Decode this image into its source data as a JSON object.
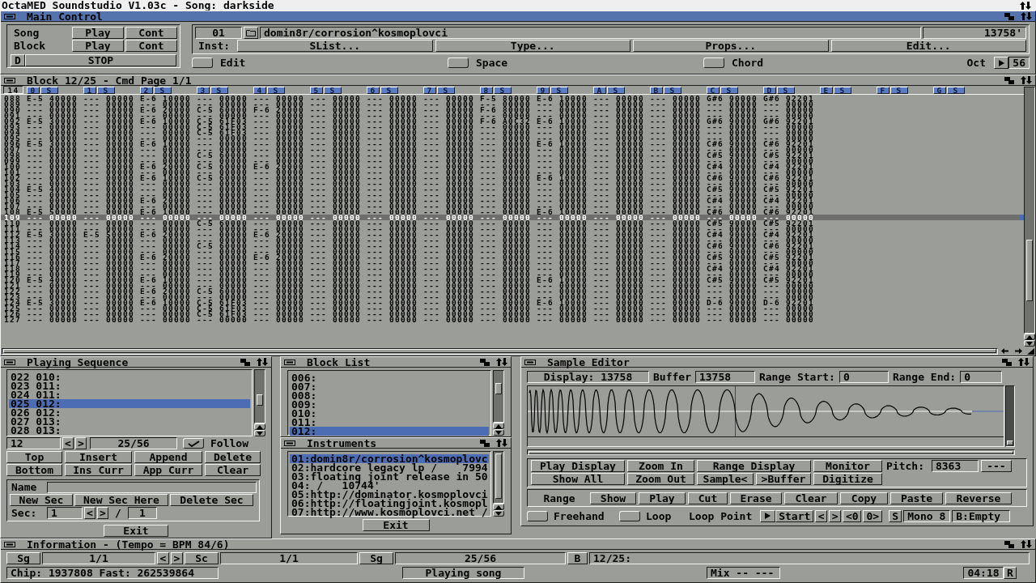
{
  "screen_title": {
    "title": "OctaMED Soundstudio V1.03c - Song: darkside"
  },
  "main_control": {
    "title": "Main Control",
    "active": true,
    "transport": [
      {
        "label": "Song",
        "play": "Play",
        "cont": "Cont"
      },
      {
        "label": "Block",
        "play": "Play",
        "cont": "Cont"
      }
    ],
    "d_button": "D",
    "stop_button": "STOP",
    "instrument": {
      "number": "01",
      "name": "domin8r/corrosion^kosmoplovci",
      "length": "13758'"
    },
    "inst_label": "Inst:",
    "inst_buttons": [
      "SList...",
      "Type...",
      "Props...",
      "Edit..."
    ],
    "toggles": [
      {
        "label": "Edit",
        "checked": false
      },
      {
        "label": "Space",
        "checked": false
      },
      {
        "label": "Chord",
        "checked": false
      }
    ],
    "octave": {
      "label": "Oct",
      "value": "56"
    }
  },
  "block_editor": {
    "title": "Block 12/25 - Cmd Page 1/1",
    "active": false,
    "corner": "14",
    "tracks": [
      {
        "number": "0",
        "button": "S"
      },
      {
        "number": "1",
        "button": "S"
      },
      {
        "number": "2",
        "button": "S"
      },
      {
        "number": "3",
        "button": "S"
      },
      {
        "number": "4",
        "button": "S"
      },
      {
        "number": "5",
        "button": "S"
      },
      {
        "number": "6",
        "button": "S"
      },
      {
        "number": "7",
        "button": "S"
      },
      {
        "number": "8",
        "button": "S"
      },
      {
        "number": "9",
        "button": "S"
      },
      {
        "number": "A",
        "button": "S"
      },
      {
        "number": "B",
        "button": "S"
      },
      {
        "number": "C",
        "button": "S"
      },
      {
        "number": "D",
        "button": "S"
      },
      {
        "number": "E",
        "button": "S"
      },
      {
        "number": "F",
        "button": "S"
      },
      {
        "number": "G",
        "button": "S"
      }
    ],
    "rows": [
      {
        "line": "088",
        "selected": false,
        "cells": [
          "E-5 40000",
          "--- 00000",
          "E-6 10000",
          "--- 00000",
          "--- 00000",
          "--- 00000",
          "--- 00000",
          "--- 00000",
          "F-5 80000",
          "E-6 10000",
          "--- 00000",
          "--- 00000",
          "G#6 90000",
          "G#6 92201"
        ]
      },
      {
        "line": "089",
        "selected": false,
        "cells": [
          "--- 00000",
          "--- 00000",
          "--- 00000",
          "--- 00000",
          "--- 00000",
          "--- 00000",
          "--- 00000",
          "--- 00000",
          "--- 00000",
          "--- 00000",
          "--- 00000",
          "--- 00000",
          "--- 00000",
          "--- 00000"
        ]
      },
      {
        "line": "090",
        "selected": false,
        "cells": [
          "--- 00000",
          "--- 00000",
          "E-6 20000",
          "C-5 60000",
          "F-6 20000",
          "--- 00000",
          "--- 00000",
          "--- 00000",
          "F-6 80000",
          "--- 00000",
          "--- 00000",
          "--- 00000",
          "--- 00000",
          "--- 00000"
        ]
      },
      {
        "line": "091",
        "selected": false,
        "cells": [
          "--- 00000",
          "--- 00000",
          "--- 00000",
          "--- 00000",
          "--- 00000",
          "--- 00000",
          "--- 00000",
          "--- 00000",
          "--- 00000",
          "--- 00000",
          "--- 00000",
          "--- 00000",
          "--- 00000",
          "--- 00000"
        ]
      },
      {
        "line": "092",
        "selected": false,
        "cells": [
          "E-5 30000",
          "--- 00000",
          "E-6 10000",
          "C-5 61F03",
          "--- 00000",
          "--- 00000",
          "--- 00000",
          "--- 00000",
          "F-6 A0C32",
          "E-6 10000",
          "--- 00000",
          "--- 00000",
          "G#6 90000",
          "G#6 92201"
        ]
      },
      {
        "line": "093",
        "selected": false,
        "cells": [
          "--- 00000",
          "--- 00000",
          "--- 00000",
          "C-5 61F03",
          "--- 00000",
          "--- 00000",
          "--- 00000",
          "--- 00000",
          "--- 00000",
          "--- 00000",
          "--- 00000",
          "--- 00000",
          "--- 00000",
          "--- 00000"
        ]
      },
      {
        "line": "094",
        "selected": false,
        "cells": [
          "--- 00000",
          "--- 00000",
          "--- 00000",
          "C-5 61F03",
          "--- 00000",
          "--- 00000",
          "--- 00000",
          "--- 00000",
          "--- 00000",
          "--- 00000",
          "--- 00000",
          "--- 00000",
          "--- 00000",
          "--- 00000"
        ]
      },
      {
        "line": "095",
        "selected": false,
        "cells": [
          "--- 00000",
          "--- 00000",
          "--- 00000",
          "--- 00000",
          "--- 00000",
          "--- 00000",
          "--- 00000",
          "--- 00000",
          "--- 00000",
          "--- 00000",
          "--- 00000",
          "--- 00000",
          "--- 00000",
          "--- 00000"
        ]
      },
      {
        "line": "096",
        "selected": false,
        "cells": [
          "E-5 30000",
          "--- 00000",
          "E-6 10000",
          "--- 00000",
          "--- 00000",
          "--- 00000",
          "--- 00000",
          "--- 00000",
          "--- 00000",
          "E-6 10000",
          "--- 00000",
          "--- 00000",
          "C#6 90000",
          "C#6 92201"
        ]
      },
      {
        "line": "097",
        "selected": false,
        "cells": [
          "--- 00000",
          "--- 00000",
          "--- 00000",
          "--- 00000",
          "--- 00000",
          "--- 00000",
          "--- 00000",
          "--- 00000",
          "--- 00000",
          "--- 00000",
          "--- 00000",
          "--- 00000",
          "--- 00000",
          "--- 00000"
        ]
      },
      {
        "line": "098",
        "selected": false,
        "cells": [
          "--- 00000",
          "--- 00000",
          "--- 00000",
          "C-5 60000",
          "--- 00000",
          "--- 00000",
          "--- 00000",
          "--- 00000",
          "--- 00000",
          "--- 00000",
          "--- 00000",
          "--- 00000",
          "C#5 90000",
          "C#5 92201"
        ]
      },
      {
        "line": "099",
        "selected": false,
        "cells": [
          "--- 00000",
          "--- 00000",
          "--- 00000",
          "--- 00000",
          "--- 00000",
          "--- 00000",
          "--- 00000",
          "--- 00000",
          "--- 00000",
          "--- 00000",
          "--- 00000",
          "--- 00000",
          "--- 00000",
          "--- 00000"
        ]
      },
      {
        "line": "100",
        "selected": false,
        "cells": [
          "--- 00000",
          "--- 00000",
          "E-6 20000",
          "C-5 60000",
          "E-6 20000",
          "--- 00000",
          "--- 00000",
          "--- 00000",
          "--- 00000",
          "--- 00000",
          "--- 00000",
          "--- 00000",
          "C#4 90000",
          "C#4 92201"
        ]
      },
      {
        "line": "101",
        "selected": false,
        "cells": [
          "--- 00000",
          "--- 00000",
          "--- 00000",
          "--- 00000",
          "--- 00000",
          "--- 00000",
          "--- 00000",
          "--- 00000",
          "--- 00000",
          "--- 00000",
          "--- 00000",
          "--- 00000",
          "--- 00000",
          "--- 00000"
        ]
      },
      {
        "line": "102",
        "selected": false,
        "cells": [
          "--- 00000",
          "--- 00000",
          "E-6 10000",
          "C-5 60000",
          "--- 00000",
          "--- 00000",
          "--- 00000",
          "--- 00000",
          "--- 00000",
          "E-6 10000",
          "--- 00000",
          "--- 00000",
          "C#6 90000",
          "C#6 92201"
        ]
      },
      {
        "line": "103",
        "selected": false,
        "cells": [
          "--- 00000",
          "--- 00000",
          "--- 00000",
          "--- 00000",
          "--- 00000",
          "--- 00000",
          "--- 00000",
          "--- 00000",
          "--- 00000",
          "--- 00000",
          "--- 00000",
          "--- 00000",
          "--- 00000",
          "--- 00000"
        ]
      },
      {
        "line": "104",
        "selected": false,
        "cells": [
          "E-5 40000",
          "--- 00000",
          "--- 00000",
          "--- 00000",
          "--- 00000",
          "--- 00000",
          "--- 00000",
          "--- 00000",
          "--- 00000",
          "--- 00000",
          "--- 00000",
          "--- 00000",
          "C#5 90000",
          "C#5 92201"
        ]
      },
      {
        "line": "105",
        "selected": false,
        "cells": [
          "--- 00000",
          "--- 00000",
          "--- 00000",
          "--- 00000",
          "--- 00000",
          "--- 00000",
          "--- 00000",
          "--- 00000",
          "--- 00000",
          "--- 00000",
          "--- 00000",
          "--- 00000",
          "--- 00000",
          "--- 00000"
        ]
      },
      {
        "line": "106",
        "selected": false,
        "cells": [
          "--- 00000",
          "--- 00000",
          "E-6 20000",
          "--- 00000",
          "--- 00000",
          "--- 00000",
          "--- 00000",
          "--- 00000",
          "--- 00000",
          "--- 00000",
          "--- 00000",
          "--- 00000",
          "C#4 90000",
          "C#4 92201"
        ]
      },
      {
        "line": "107",
        "selected": false,
        "cells": [
          "--- 00000",
          "--- 00000",
          "--- 00000",
          "--- 00000",
          "--- 00000",
          "--- 00000",
          "--- 00000",
          "--- 00000",
          "--- 00000",
          "--- 00000",
          "--- 00000",
          "--- 00000",
          "--- 00000",
          "--- 00000"
        ]
      },
      {
        "line": "108",
        "selected": false,
        "cells": [
          "E-5 50000",
          "--- 00000",
          "E-6 10000",
          "--- 00000",
          "--- 00000",
          "--- 00000",
          "--- 00000",
          "--- 00000",
          "--- 00000",
          "E-6 10000",
          "--- 00000",
          "--- 00000",
          "C#6 90000",
          "C#6 92201"
        ]
      },
      {
        "line": "109",
        "selected": true,
        "cells": [
          "--- 00000",
          "--- 00000",
          "--- 00000",
          "--- 00000",
          "--- 00000",
          "--- 00000",
          "--- 00000",
          "--- 00000",
          "--- 00000",
          "--- 00000",
          "--- 00000",
          "--- 00000",
          "--- 00000",
          "--- 00000"
        ]
      },
      {
        "line": "110",
        "selected": false,
        "cells": [
          "--- 00000",
          "--- 00000",
          "--- 00000",
          "C-5 60000",
          "--- 00000",
          "--- 00000",
          "--- 00000",
          "--- 00000",
          "--- 00000",
          "--- 00000",
          "--- 00000",
          "--- 00000",
          "C#5 90000",
          "C#5 92201"
        ]
      },
      {
        "line": "111",
        "selected": false,
        "cells": [
          "--- 00000",
          "--- 00000",
          "--- 00000",
          "--- 00000",
          "--- 00000",
          "--- 00000",
          "--- 00000",
          "--- 00000",
          "--- 00000",
          "--- 00000",
          "--- 00000",
          "--- 00000",
          "--- 00000",
          "--- 00000"
        ]
      },
      {
        "line": "112",
        "selected": false,
        "cells": [
          "E-5 30000",
          "E-5 50000",
          "E-6 20000",
          "--- 00000",
          "E-6 20000",
          "--- 00000",
          "--- 00000",
          "--- 00000",
          "--- 00000",
          "--- 00000",
          "--- 00000",
          "--- 00000",
          "C#4 90000",
          "C#4 92201"
        ]
      },
      {
        "line": "113",
        "selected": false,
        "cells": [
          "--- 00000",
          "--- 00000",
          "--- 00000",
          "--- 00000",
          "--- 00000",
          "--- 00000",
          "--- 00000",
          "--- 00000",
          "--- 00000",
          "--- 00000",
          "--- 00000",
          "--- 00000",
          "--- 00000",
          "--- 00000"
        ]
      },
      {
        "line": "114",
        "selected": false,
        "cells": [
          "--- 00000",
          "--- 00000",
          "--- 00000",
          "C-5 60000",
          "--- 00000",
          "--- 00000",
          "--- 00000",
          "--- 00000",
          "--- 00000",
          "--- 00000",
          "--- 00000",
          "--- 00000",
          "C#6 90000",
          "C#6 92201"
        ]
      },
      {
        "line": "115",
        "selected": false,
        "cells": [
          "--- 00000",
          "--- 00000",
          "--- 00000",
          "--- 00000",
          "--- 00000",
          "--- 00000",
          "--- 00000",
          "--- 00000",
          "--- 00000",
          "--- 00000",
          "--- 00000",
          "--- 00000",
          "--- 00000",
          "--- 00000"
        ]
      },
      {
        "line": "116",
        "selected": false,
        "cells": [
          "--- 00000",
          "--- 00000",
          "E-6 20000",
          "--- 00000",
          "E-6 20000",
          "--- 00000",
          "--- 00000",
          "--- 00000",
          "--- 00000",
          "--- 00000",
          "--- 00000",
          "--- 00000",
          "C#5 90000",
          "C#5 92201"
        ]
      },
      {
        "line": "117",
        "selected": false,
        "cells": [
          "--- 00000",
          "--- 00000",
          "--- 00000",
          "--- 00000",
          "--- 00000",
          "--- 00000",
          "--- 00000",
          "--- 00000",
          "--- 00000",
          "--- 00000",
          "--- 00000",
          "--- 00000",
          "--- 00000",
          "--- 00000"
        ]
      },
      {
        "line": "118",
        "selected": false,
        "cells": [
          "--- 00000",
          "--- 00000",
          "--- 00000",
          "--- 00000",
          "--- 00000",
          "--- 00000",
          "--- 00000",
          "--- 00000",
          "--- 00000",
          "--- 00000",
          "--- 00000",
          "--- 00000",
          "C#4 90000",
          "C#4 92201"
        ]
      },
      {
        "line": "119",
        "selected": false,
        "cells": [
          "--- 00000",
          "--- 00000",
          "--- 00000",
          "--- 00000",
          "--- 00000",
          "--- 00000",
          "--- 00000",
          "--- 00000",
          "--- 00000",
          "--- 00000",
          "--- 00000",
          "--- 00000",
          "--- 00000",
          "--- 00000"
        ]
      },
      {
        "line": "120",
        "selected": false,
        "cells": [
          "E-5 40000",
          "--- 00000",
          "E-6 10000",
          "--- 00000",
          "--- 00000",
          "--- 00000",
          "--- 00000",
          "--- 00000",
          "--- 00000",
          "E-6 10000",
          "--- 00000",
          "--- 00000",
          "C#5 90000",
          "C#5 92201"
        ]
      },
      {
        "line": "121",
        "selected": false,
        "cells": [
          "--- 00000",
          "--- 00000",
          "--- 00000",
          "--- 00000",
          "--- 00000",
          "--- 00000",
          "--- 00000",
          "--- 00000",
          "--- 00000",
          "--- 00000",
          "--- 00000",
          "--- 00000",
          "--- 00000",
          "--- 00000"
        ]
      },
      {
        "line": "122",
        "selected": false,
        "cells": [
          "--- 00000",
          "--- 00000",
          "E-6 20000",
          "C-5 60000",
          "--- 00000",
          "--- 00000",
          "--- 00000",
          "--- 00000",
          "--- 00000",
          "--- 00000",
          "--- 00000",
          "--- 00000",
          "--- 00000",
          "--- 00000"
        ]
      },
      {
        "line": "123",
        "selected": false,
        "cells": [
          "--- 00000",
          "--- 00000",
          "--- 00000",
          "--- 00000",
          "--- 00000",
          "--- 00000",
          "--- 00000",
          "--- 00000",
          "--- 00000",
          "--- 00000",
          "--- 00000",
          "--- 00000",
          "--- 00000",
          "--- 00000"
        ]
      },
      {
        "line": "124",
        "selected": false,
        "cells": [
          "E-5 30000",
          "--- 00000",
          "E-6 10000",
          "C-5 61F03",
          "--- 00000",
          "--- 00000",
          "--- 00000",
          "--- 00000",
          "--- 00000",
          "E-6 10000",
          "--- 00000",
          "--- 00000",
          "D-6 90000",
          "D-6 92201"
        ]
      },
      {
        "line": "125",
        "selected": false,
        "cells": [
          "--- 00000",
          "--- 00000",
          "--- 00000",
          "C-5 61F03",
          "--- 00000",
          "--- 00000",
          "--- 00000",
          "--- 00000",
          "--- 00000",
          "--- 00000",
          "--- 00000",
          "--- 00000",
          "--- 00000",
          "--- 00000"
        ]
      },
      {
        "line": "126",
        "selected": false,
        "cells": [
          "--- 00000",
          "--- 00000",
          "--- 00000",
          "C-5 61F03",
          "--- 00000",
          "--- 00000",
          "--- 00000",
          "--- 00000",
          "--- 00000",
          "--- 00000",
          "--- 00000",
          "--- 00000",
          "--- 00000",
          "--- 00000"
        ]
      },
      {
        "line": "127",
        "selected": false,
        "cells": [
          "--- 00000",
          "--- 00000",
          "--- 00000",
          "--- 00000",
          "--- 00000",
          "--- 00000",
          "--- 00000",
          "--- 00000",
          "--- 00000",
          "--- 00000",
          "--- 00000",
          "--- 00000",
          "--- 00000",
          "--- 00000"
        ]
      }
    ]
  },
  "playing_sequence": {
    "title": "Playing Sequence",
    "active": false,
    "entries": [
      {
        "text": "022 010:",
        "selected": false
      },
      {
        "text": "023 011:",
        "selected": false
      },
      {
        "text": "024 011:",
        "selected": false
      },
      {
        "text": "025 012:",
        "selected": true
      },
      {
        "text": "026 012:",
        "selected": false
      },
      {
        "text": "027 013:",
        "selected": false
      },
      {
        "text": "028 013:",
        "selected": false
      }
    ],
    "block_field": "12",
    "prev": "<",
    "next": ">",
    "position": "25/56",
    "follow": {
      "label": "Follow",
      "checked": true
    },
    "buttons": [
      "Top",
      "Insert",
      "Append",
      "Delete",
      "Bottom",
      "Ins Curr",
      "App Curr",
      "Clear"
    ],
    "section": {
      "name_label": "Name",
      "buttons": [
        "New Sec",
        "New Sec Here",
        "Delete Sec"
      ],
      "sec_label": "Sec:",
      "sec_value": "1",
      "prev": "<",
      "next": ">",
      "separator": "/",
      "sec_total": "1"
    },
    "exit": "Exit"
  },
  "block_list": {
    "title": "Block List",
    "active": false,
    "entries": [
      {
        "text": "006:",
        "selected": false
      },
      {
        "text": "007:",
        "selected": false
      },
      {
        "text": "008:",
        "selected": false
      },
      {
        "text": "009:",
        "selected": false
      },
      {
        "text": "010:",
        "selected": false
      },
      {
        "text": "011:",
        "selected": false
      },
      {
        "text": "012:",
        "selected": true
      }
    ]
  },
  "instruments": {
    "title": "Instruments",
    "active": false,
    "entries": [
      {
        "text": "01:domin8r/corrosion^kosmoplovc",
        "selected": true
      },
      {
        "text": "02:hardcore legacy lp /    7994",
        "selected": false
      },
      {
        "text": "03:floating joint release in 50",
        "selected": false
      },
      {
        "text": "04: /   10744'",
        "selected": false
      },
      {
        "text": "05:http://dominator.kosmoplovci",
        "selected": false
      },
      {
        "text": "06:http://floatingjoint.kosmopl",
        "selected": false
      },
      {
        "text": "07:http://www.kosmoplovci.net /",
        "selected": false
      }
    ],
    "exit": "Exit"
  },
  "sample_editor": {
    "title": "Sample Editor",
    "active": false,
    "display": "Display: 13758",
    "buffer_label": "Buffer",
    "buffer": "13758",
    "range_start_label": "Range Start:",
    "range_start": "0",
    "range_end_label": "Range End:",
    "range_end": "0",
    "view_buttons_top": [
      "Play Display",
      "Zoom In",
      "Range Display",
      "Monitor"
    ],
    "pitch_label": "Pitch:",
    "pitch": "8363",
    "pitch_button": "---",
    "view_buttons_bottom": [
      "Show All",
      "Zoom Out",
      "Sample<",
      ">Buffer",
      "Digitize"
    ],
    "range_label": "Range",
    "range_buttons": [
      "Show",
      "Play",
      "Cut",
      "Erase",
      "Clear",
      "Copy",
      "Paste",
      "Reverse"
    ],
    "toggles": [
      {
        "label": "Freehand",
        "checked": false
      },
      {
        "label": "Loop",
        "checked": false
      }
    ],
    "loop_point_label": "Loop Point",
    "loop_buttons": [
      "Start",
      "<",
      ">",
      "<0",
      "0>"
    ],
    "s_button": "S",
    "mode": "Mono 8",
    "buffer_state": "B:Empty"
  },
  "information": {
    "title": "Information - (Tempo = BPM 84/6)",
    "active": false,
    "song_button": "Sg",
    "song_position": "1/1",
    "prev": "<",
    "next": ">",
    "section_button": "Sc",
    "section_position": "1/1",
    "sequence_button": "Sg",
    "sequence_position": "25/56",
    "block_button": "B",
    "block_position": "12/25:",
    "memory": "Chip: 1937808 Fast: 262539864",
    "status": "Playing song",
    "mix": "Mix -- ---",
    "time": "04:18",
    "r_button": "R"
  }
}
